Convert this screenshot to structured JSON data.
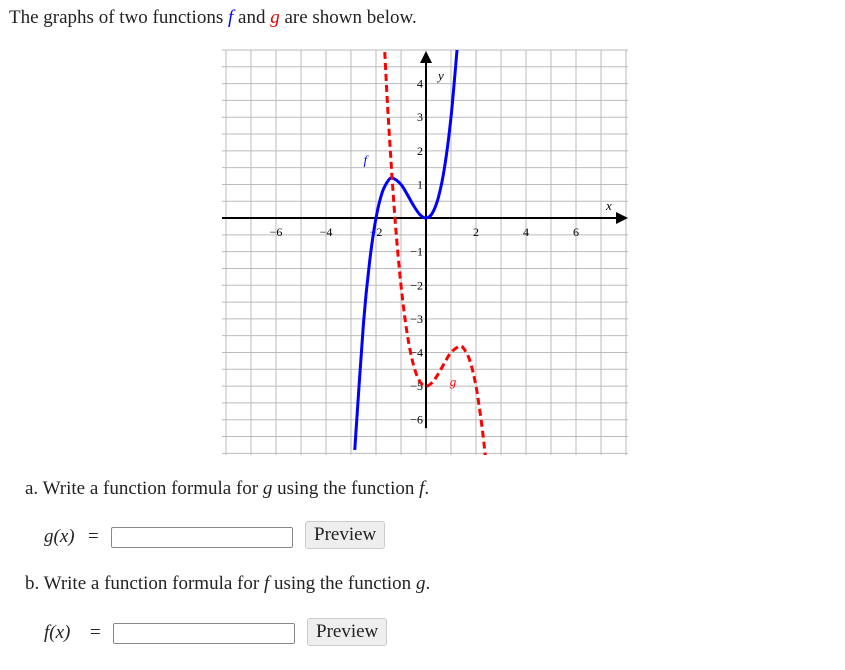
{
  "intro": {
    "pre": "The graphs of two functions ",
    "f": "f",
    "mid": " and ",
    "g": "g",
    "post": " are shown below."
  },
  "chart_data": {
    "type": "line",
    "xlabel": "x",
    "ylabel": "y",
    "xlim": [
      -8.16,
      8.08
    ],
    "ylim": [
      -7.05,
      5
    ],
    "grid": true,
    "x_ticks": [
      "−6",
      "−4",
      "−2",
      "2",
      "4",
      "6"
    ],
    "x_tick_values": [
      -6,
      -4,
      -2,
      2,
      4,
      6
    ],
    "y_ticks": [
      "4",
      "3",
      "2",
      "1",
      "−1",
      "−2",
      "−3",
      "−4",
      "−5",
      "−6"
    ],
    "y_tick_values": [
      4,
      3,
      2,
      1,
      -1,
      -2,
      -3,
      -4,
      -5,
      -6
    ],
    "series": [
      {
        "name": "f",
        "color": "#0000ff",
        "style": "solid",
        "x": [
          -2.85,
          -2.5,
          -2.25,
          -2,
          -1.75,
          -1.5,
          -1.33,
          -1,
          -0.75,
          -0.5,
          -0.25,
          0,
          0.25,
          0.5,
          0.75,
          1,
          1.25
        ],
        "y": [
          -6.9,
          -3.125,
          -1.266,
          0,
          0.766,
          1.125,
          1.185,
          1,
          0.703,
          0.375,
          0.109,
          0,
          0.141,
          0.625,
          1.547,
          3,
          5.078
        ],
        "label_at": [
          -2.5,
          1.6
        ]
      },
      {
        "name": "g",
        "color": "#ff0000",
        "style": "dashed",
        "x": [
          -1.65,
          -1.5,
          -1.25,
          -1,
          -0.75,
          -0.5,
          -0.25,
          0,
          0.25,
          0.5,
          0.75,
          1,
          1.33,
          1.5,
          1.75,
          2,
          2.25,
          2.37
        ],
        "y": [
          4.94,
          2.875,
          0.078,
          -2,
          -3.453,
          -4.375,
          -4.859,
          -5,
          -4.891,
          -4.625,
          -4.297,
          -4,
          -3.815,
          -3.875,
          -4.234,
          -5,
          -6.266,
          -7.08
        ],
        "label_at": [
          0.95,
          -5.0
        ]
      }
    ]
  },
  "part_a": {
    "pre": "a. Write a function formula for ",
    "v1": "g",
    "mid": " using the function ",
    "v2": "f",
    "post": ".",
    "lhs": "g(x)",
    "eq": "=",
    "value": "",
    "preview": "Preview"
  },
  "part_b": {
    "pre": "b. Write a function formula for ",
    "v1": "f",
    "mid": " using the function ",
    "v2": "g",
    "post": ".",
    "lhs": "f(x)",
    "eq": "=",
    "value": "",
    "preview": "Preview"
  }
}
